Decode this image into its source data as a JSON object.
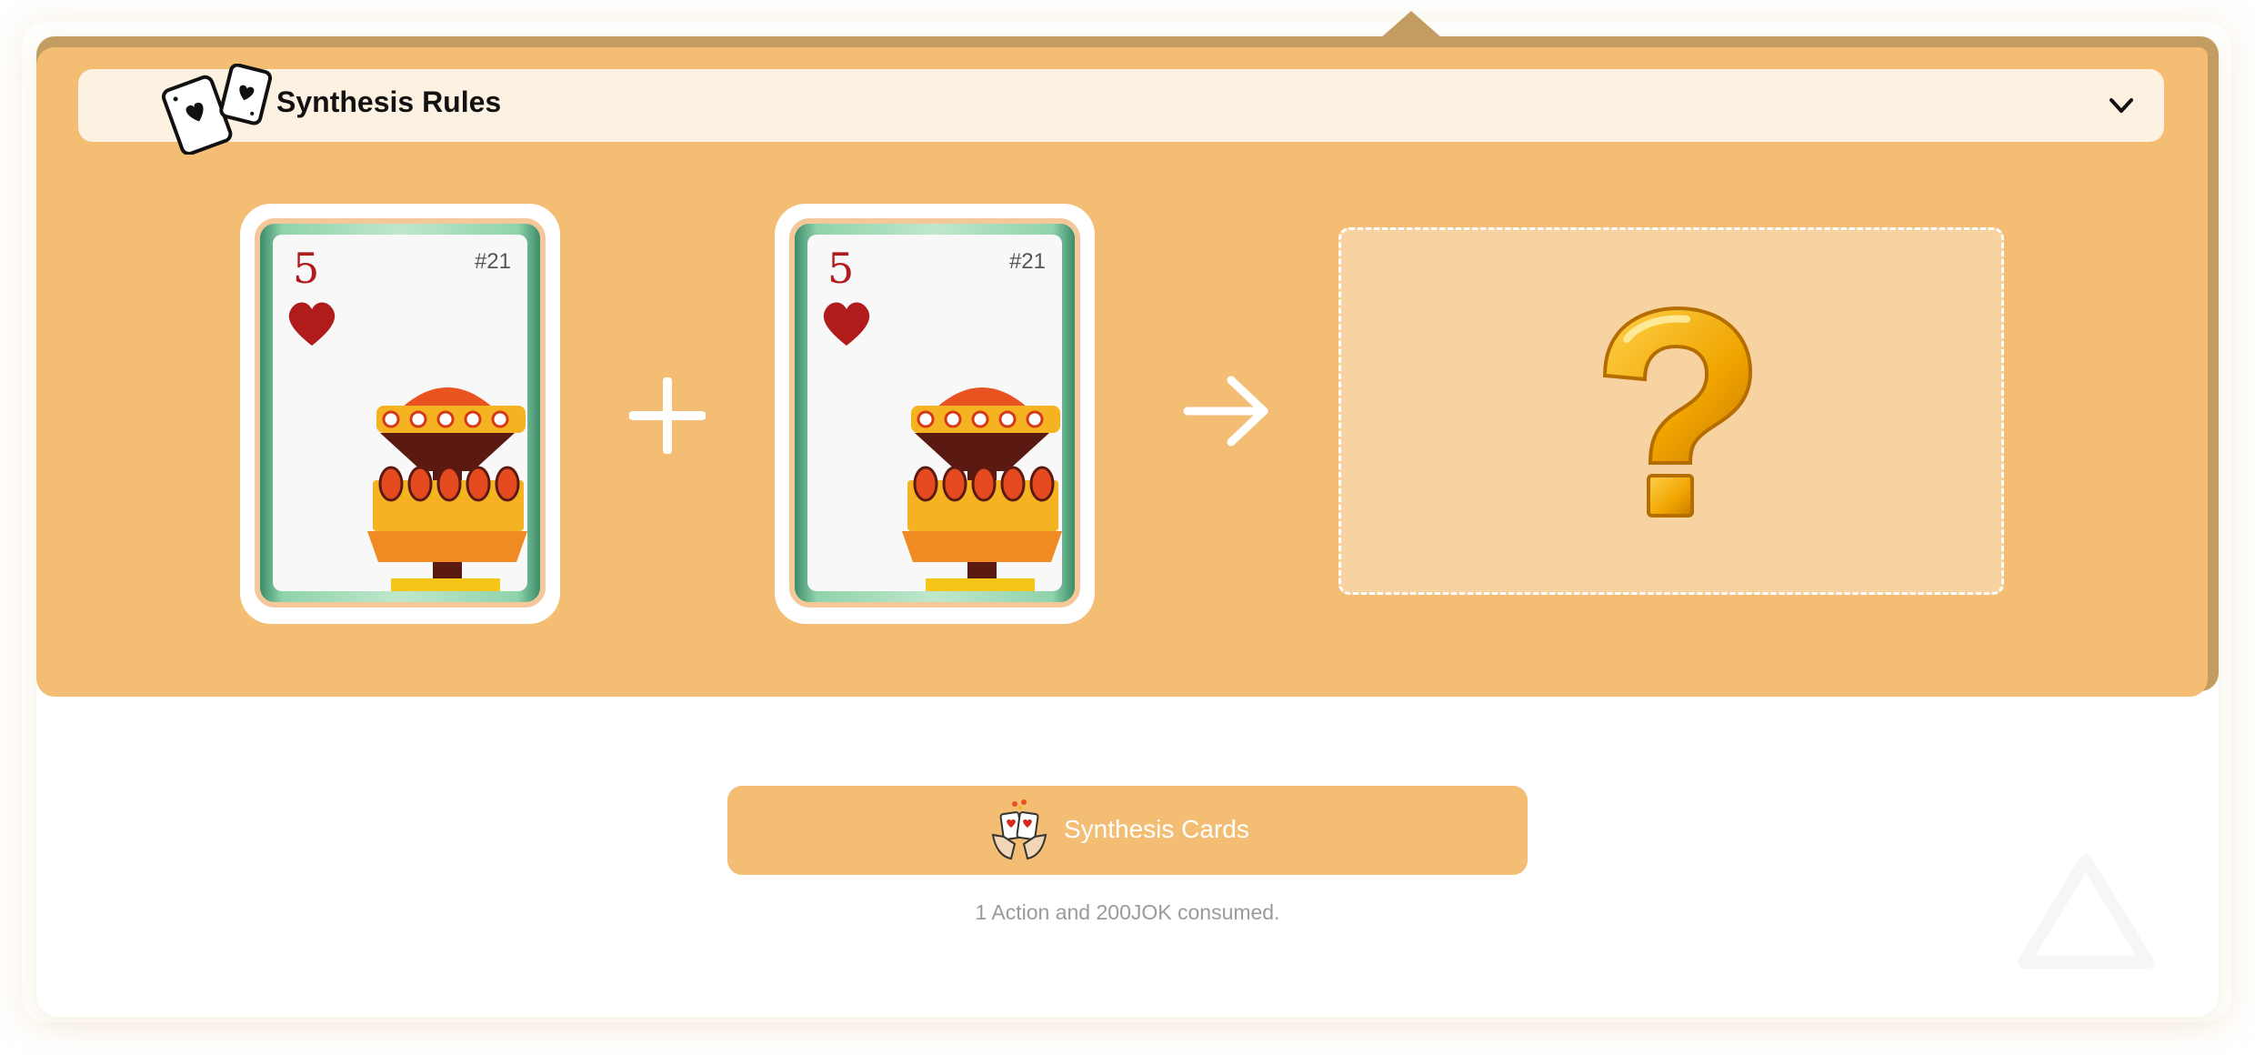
{
  "header": {
    "title": "Synthesis Rules",
    "icons": {
      "cards": "playing-cards-icon",
      "chevron": "chevron-down-icon"
    }
  },
  "synthesis": {
    "input_cards": [
      {
        "rank": "5",
        "suit": "heart",
        "number": "#21",
        "art": "FREEFALL"
      },
      {
        "rank": "5",
        "suit": "heart",
        "number": "#21",
        "art": "FREEFALL"
      }
    ],
    "operator_icon": "plus-icon",
    "result_icon": "arrow-right-icon",
    "result_placeholder_icon": "question-mark-icon"
  },
  "action": {
    "button_label": "Synthesis Cards",
    "button_icon": "hands-holding-cards-icon",
    "cost_note": "1 Action and 200JOK consumed."
  },
  "colors": {
    "panel": "#f3bd73",
    "panel_shadow": "#c39c62",
    "rules_bar": "#fdf1e1",
    "suit_red": "#b01c1c",
    "button": "#f3bd73"
  }
}
